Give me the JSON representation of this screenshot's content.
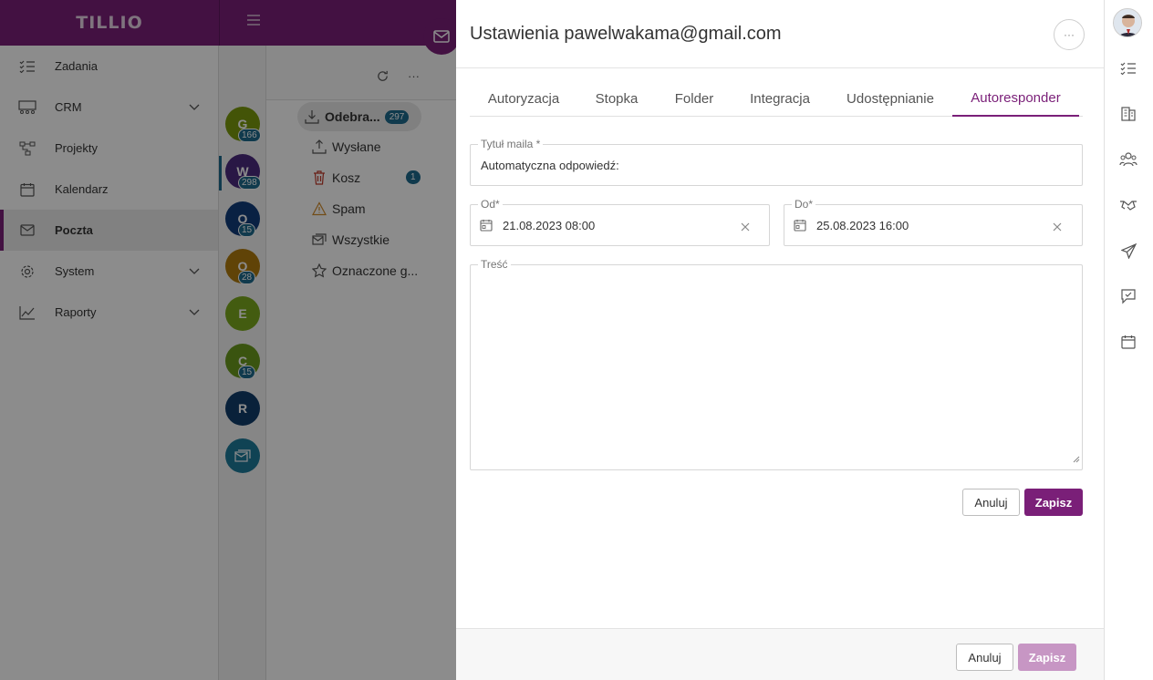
{
  "app": {
    "logo": "TILLIO",
    "brand_color": "#7a1f78"
  },
  "sidebar": {
    "items": [
      {
        "label": "Zadania",
        "icon": "tasks-icon"
      },
      {
        "label": "CRM",
        "icon": "crm-icon",
        "has_submenu": true
      },
      {
        "label": "Projekty",
        "icon": "projects-icon"
      },
      {
        "label": "Kalendarz",
        "icon": "calendar-icon"
      },
      {
        "label": "Poczta",
        "icon": "mail-icon",
        "active": true
      },
      {
        "label": "System",
        "icon": "gear-icon",
        "has_submenu": true
      },
      {
        "label": "Raporty",
        "icon": "chart-icon",
        "has_submenu": true
      }
    ]
  },
  "accounts": [
    {
      "letter": "G",
      "count": "166",
      "color": "#7a9a0e"
    },
    {
      "letter": "W",
      "count": "298",
      "color": "#4b2a7e"
    },
    {
      "letter": "O",
      "count": "15",
      "color": "#123c7a"
    },
    {
      "letter": "O",
      "count": "28",
      "color": "#b07a0e"
    },
    {
      "letter": "E",
      "count": "",
      "color": "#7aa81e"
    },
    {
      "letter": "C",
      "count": "15",
      "color": "#6a9a1e"
    },
    {
      "letter": "R",
      "count": "",
      "color": "#123c6a"
    }
  ],
  "folders": [
    {
      "label": "Odebra...",
      "badge": "297",
      "icon": "inbox-icon",
      "selected": true
    },
    {
      "label": "Wysłane",
      "badge": "",
      "icon": "sent-icon"
    },
    {
      "label": "Kosz",
      "badge": "1",
      "icon": "trash-icon"
    },
    {
      "label": "Spam",
      "badge": "",
      "icon": "warning-icon"
    },
    {
      "label": "Wszystkie",
      "badge": "",
      "icon": "all-mail-icon"
    },
    {
      "label": "Oznaczone g...",
      "badge": "",
      "icon": "star-icon"
    }
  ],
  "panel": {
    "title": "Ustawienia pawelwakama@gmail.com",
    "more_label": "···",
    "tabs": [
      {
        "label": "Autoryzacja"
      },
      {
        "label": "Stopka"
      },
      {
        "label": "Folder"
      },
      {
        "label": "Integracja"
      },
      {
        "label": "Udostępnianie"
      },
      {
        "label": "Autoresponder",
        "active": true
      }
    ],
    "form": {
      "subject_label": "Tytuł maila *",
      "subject_value": "Automatyczna odpowiedź:",
      "from_label": "Od*",
      "from_value": "21.08.2023 08:00",
      "to_label": "Do*",
      "to_value": "25.08.2023 16:00",
      "body_label": "Treść",
      "body_value": "",
      "cancel_label": "Anuluj",
      "save_label": "Zapisz"
    },
    "footer": {
      "cancel_label": "Anuluj",
      "save_label": "Zapisz"
    }
  },
  "rail": [
    "avatar",
    "tasks-icon",
    "building-icon",
    "people-icon",
    "handshake-icon",
    "send-icon",
    "chat-check-icon",
    "calendar-icon"
  ]
}
